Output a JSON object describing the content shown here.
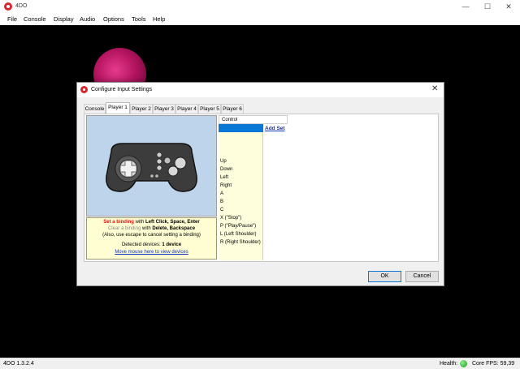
{
  "app": {
    "title": "4DO"
  },
  "menu": [
    "File",
    "Console",
    "Display",
    "Audio",
    "Options",
    "Tools",
    "Help"
  ],
  "window_controls": {
    "minimize": "—",
    "maximize": "☐",
    "close": "✕"
  },
  "status": {
    "version": "4DO 1.3.2.4",
    "health_label": "Health:",
    "fps": "Core FPS:  59,39",
    "health_color": "#1a9a1a"
  },
  "dialog": {
    "title": "Configure Input Settings",
    "close": "✕",
    "tabs": [
      "Console",
      "Player 1",
      "Player 2",
      "Player 3",
      "Player 4",
      "Player 5",
      "Player 6"
    ],
    "active_tab": "Player 1",
    "hint": {
      "set_binding": "Set a binding",
      "with1": "with",
      "set_keys": "Left Click, Space, Enter",
      "clear_binding": "Clear a binding",
      "with2": "with",
      "clear_keys": "Delete, Backspace",
      "escape_note": "(Also, use escape to cancel setting a binding)",
      "devices_label": "Detected devices:",
      "devices_value": "1 device",
      "view_devices": "Move mouse here to view devices"
    },
    "grid": {
      "header": "Control",
      "add_set": "Add Set",
      "controls": [
        "Up",
        "Down",
        "Left",
        "Right",
        "A",
        "B",
        "C",
        "X (\"Stop\")",
        "P (\"Play/Pause\")",
        "L (Left Shoulder)",
        "R (Right Shoulder)"
      ]
    },
    "buttons": {
      "ok": "OK",
      "cancel": "Cancel"
    }
  }
}
